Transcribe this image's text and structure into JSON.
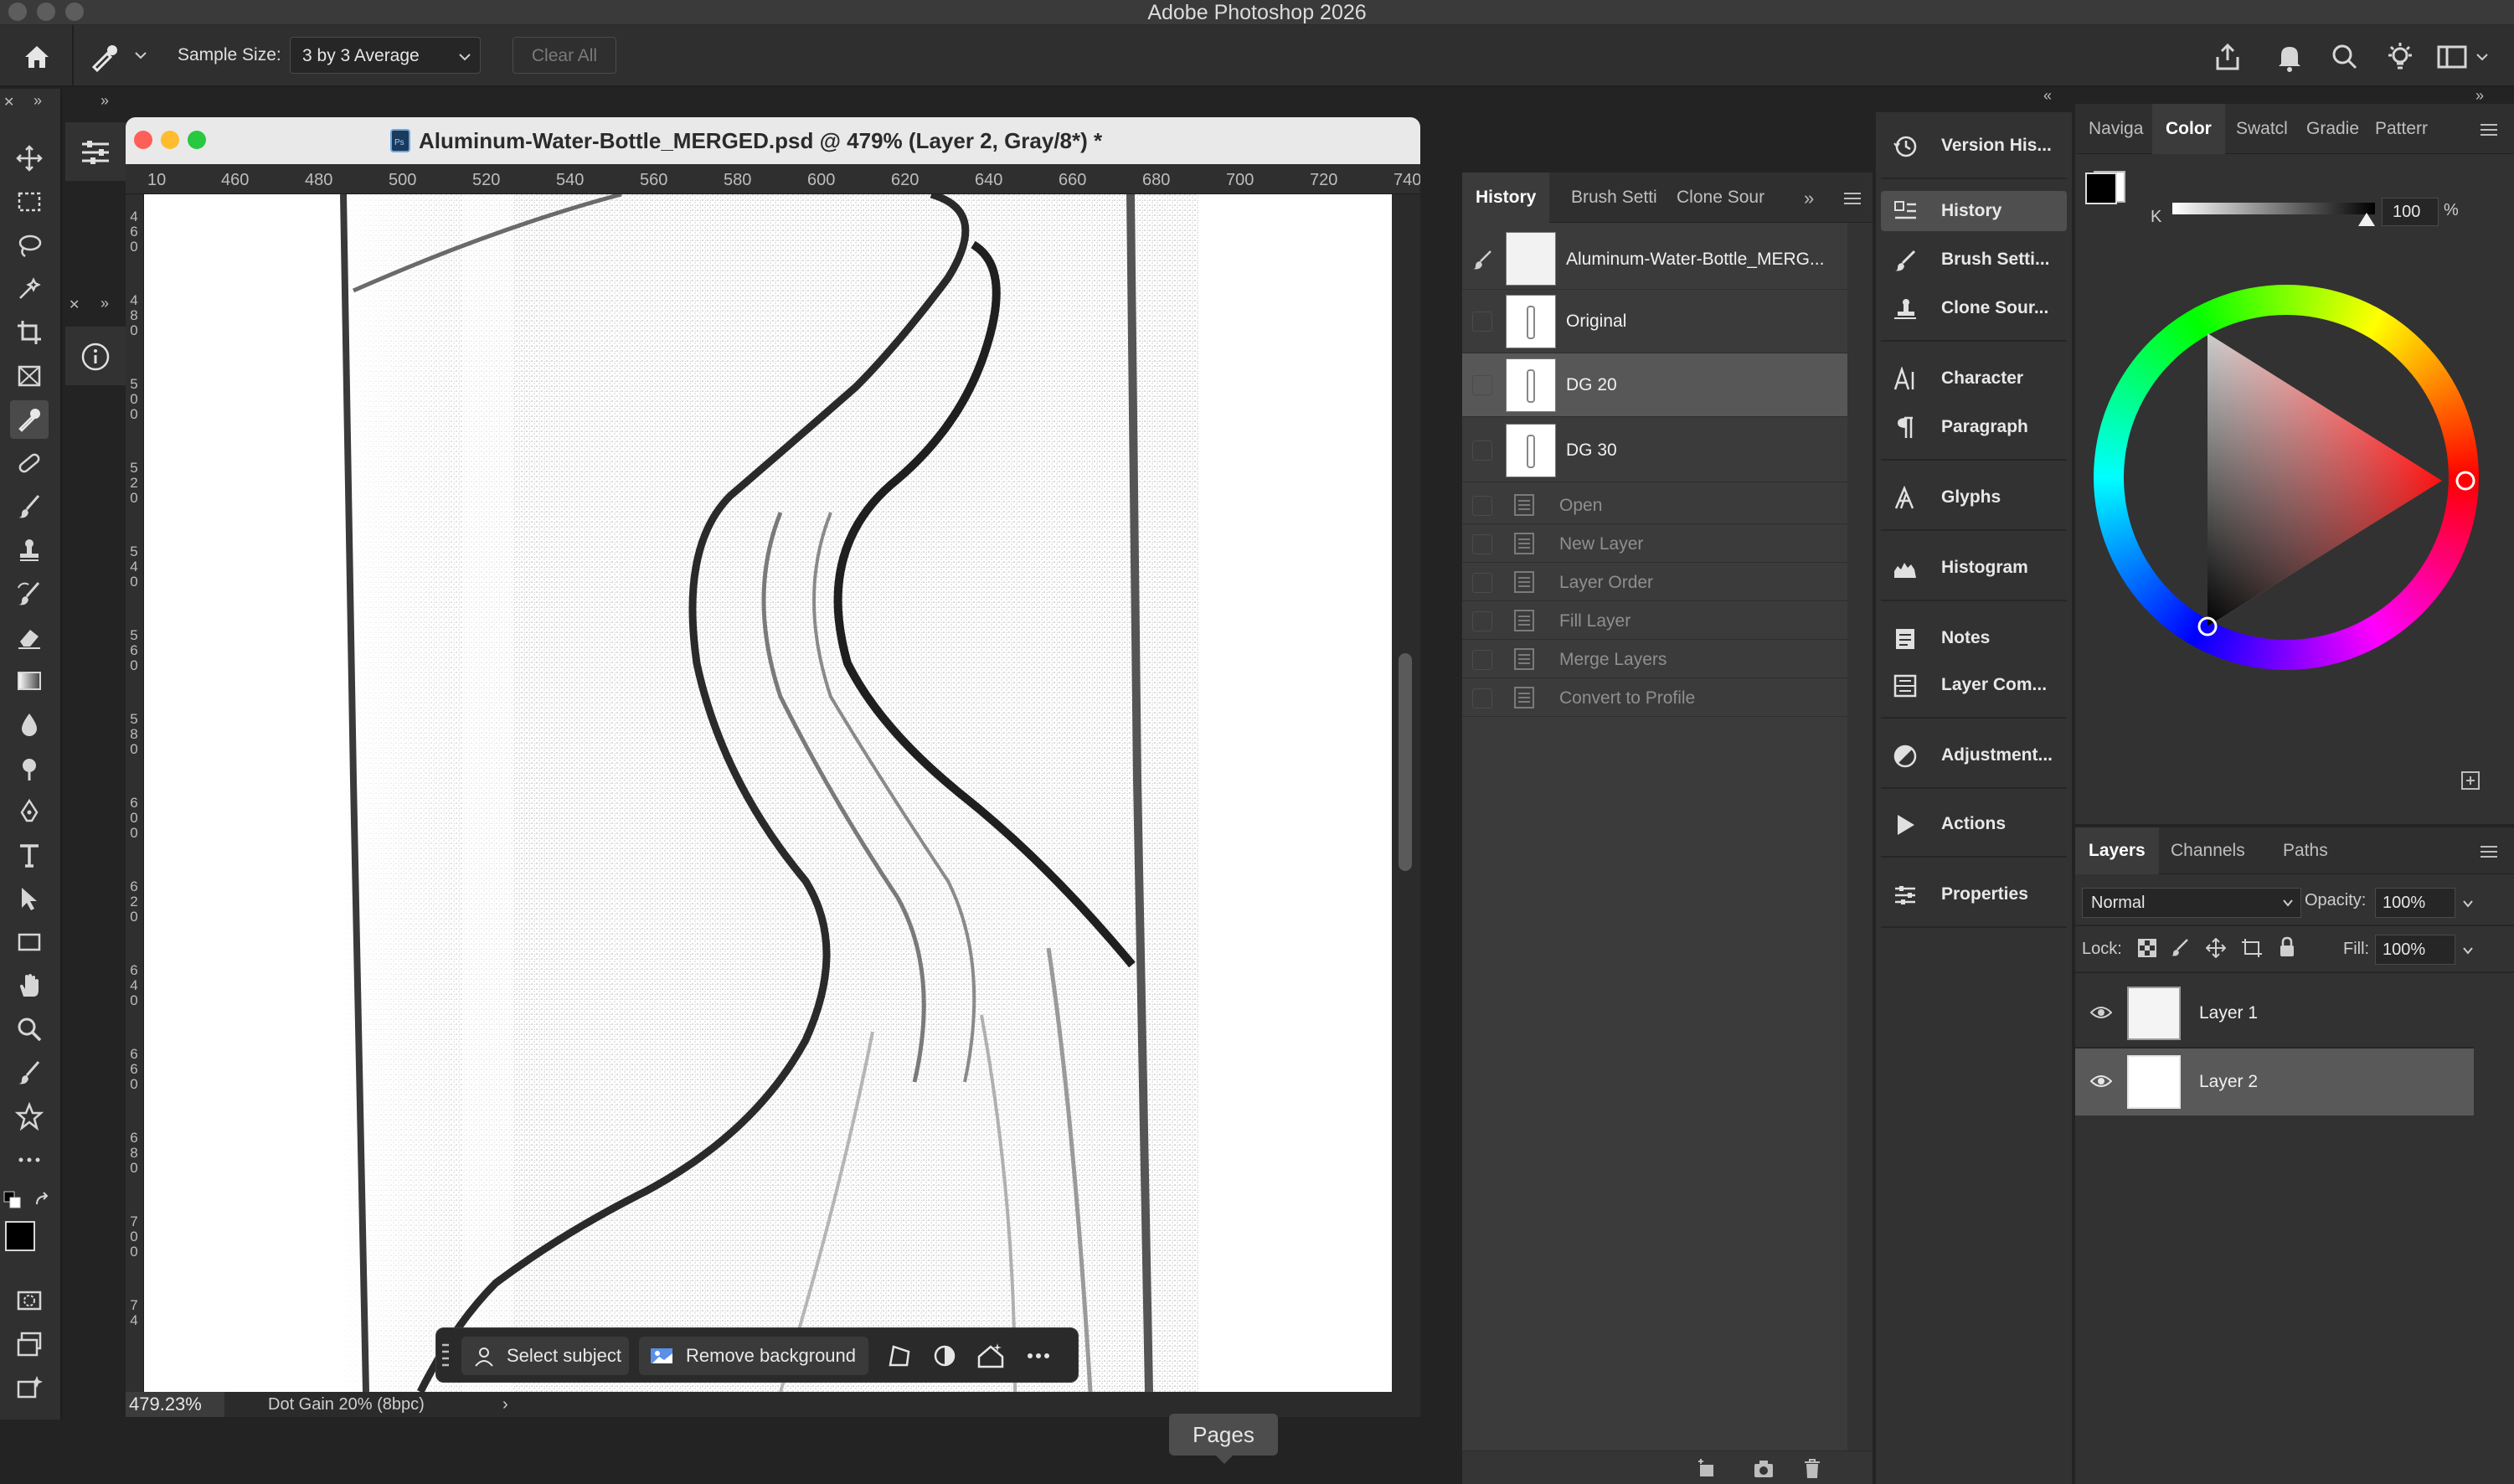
{
  "app": {
    "title": "Adobe Photoshop 2026"
  },
  "options_bar": {
    "sample_size_label": "Sample Size:",
    "sample_size_value": "3 by 3 Average",
    "clear_all_label": "Clear All"
  },
  "document": {
    "tab_title": "Aluminum-Water-Bottle_MERGED.psd @ 479% (Layer 2, Gray/8*) *",
    "zoom_level": "479.23%",
    "status_info": "Dot Gain 20% (8bpc)",
    "hruler_labels": [
      "10",
      "460",
      "480",
      "500",
      "520",
      "540",
      "560",
      "580",
      "600",
      "620",
      "640",
      "660",
      "680",
      "700",
      "720",
      "740"
    ],
    "vruler_labels": [
      "460",
      "480",
      "500",
      "520",
      "540",
      "560",
      "580",
      "600",
      "620",
      "640",
      "660",
      "680",
      "700",
      "74"
    ]
  },
  "context_bar": {
    "select_subject": "Select subject",
    "remove_background": "Remove background"
  },
  "pages_tooltip": "Pages",
  "history_panel": {
    "tabs": [
      "History",
      "Brush Setti",
      "Clone Sour"
    ],
    "snapshots": [
      {
        "label": "Aluminum-Water-Bottle_MERG..."
      },
      {
        "label": "Original"
      },
      {
        "label": "DG 20"
      },
      {
        "label": "DG 30"
      }
    ],
    "states": [
      "Open",
      "New Layer",
      "Layer Order",
      "Fill Layer",
      "Merge Layers",
      "Convert to Profile"
    ]
  },
  "panel_dock": {
    "items": [
      {
        "label": "Version His...",
        "icon": "version-history-icon"
      },
      {
        "label": "History",
        "icon": "history-icon"
      },
      {
        "label": "Brush Setti...",
        "icon": "brush-settings-icon"
      },
      {
        "label": "Clone Sour...",
        "icon": "clone-source-icon"
      },
      {
        "label": "Character",
        "icon": "character-icon"
      },
      {
        "label": "Paragraph",
        "icon": "paragraph-icon"
      },
      {
        "label": "Glyphs",
        "icon": "glyphs-icon"
      },
      {
        "label": "Histogram",
        "icon": "histogram-icon"
      },
      {
        "label": "Notes",
        "icon": "notes-icon"
      },
      {
        "label": "Layer Com...",
        "icon": "layer-comps-icon"
      },
      {
        "label": "Adjustment...",
        "icon": "adjustments-icon"
      },
      {
        "label": "Actions",
        "icon": "actions-icon"
      },
      {
        "label": "Properties",
        "icon": "properties-icon"
      }
    ]
  },
  "color_panel": {
    "tabs": [
      "Naviga",
      "Color",
      "Swatcl",
      "Gradie",
      "Patterr"
    ],
    "channel_label": "K",
    "value": "100",
    "unit": "%",
    "foreground_color": "#000000",
    "background_color": "#ffffff"
  },
  "layers_panel": {
    "tabs": [
      "Layers",
      "Channels",
      "Paths"
    ],
    "blend_mode": "Normal",
    "opacity_label": "Opacity:",
    "opacity_value": "100%",
    "lock_label": "Lock:",
    "fill_label": "Fill:",
    "fill_value": "100%",
    "layers": [
      {
        "name": "Layer 1"
      },
      {
        "name": "Layer 2"
      }
    ]
  }
}
